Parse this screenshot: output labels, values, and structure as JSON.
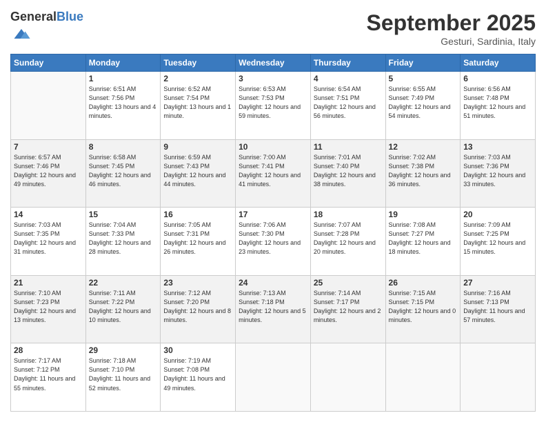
{
  "logo": {
    "general": "General",
    "blue": "Blue"
  },
  "header": {
    "month": "September 2025",
    "location": "Gesturi, Sardinia, Italy"
  },
  "weekdays": [
    "Sunday",
    "Monday",
    "Tuesday",
    "Wednesday",
    "Thursday",
    "Friday",
    "Saturday"
  ],
  "weeks": [
    [
      {
        "day": "",
        "info": ""
      },
      {
        "day": "1",
        "info": "Sunrise: 6:51 AM\nSunset: 7:56 PM\nDaylight: 13 hours\nand 4 minutes."
      },
      {
        "day": "2",
        "info": "Sunrise: 6:52 AM\nSunset: 7:54 PM\nDaylight: 13 hours\nand 1 minute."
      },
      {
        "day": "3",
        "info": "Sunrise: 6:53 AM\nSunset: 7:53 PM\nDaylight: 12 hours\nand 59 minutes."
      },
      {
        "day": "4",
        "info": "Sunrise: 6:54 AM\nSunset: 7:51 PM\nDaylight: 12 hours\nand 56 minutes."
      },
      {
        "day": "5",
        "info": "Sunrise: 6:55 AM\nSunset: 7:49 PM\nDaylight: 12 hours\nand 54 minutes."
      },
      {
        "day": "6",
        "info": "Sunrise: 6:56 AM\nSunset: 7:48 PM\nDaylight: 12 hours\nand 51 minutes."
      }
    ],
    [
      {
        "day": "7",
        "info": "Sunrise: 6:57 AM\nSunset: 7:46 PM\nDaylight: 12 hours\nand 49 minutes."
      },
      {
        "day": "8",
        "info": "Sunrise: 6:58 AM\nSunset: 7:45 PM\nDaylight: 12 hours\nand 46 minutes."
      },
      {
        "day": "9",
        "info": "Sunrise: 6:59 AM\nSunset: 7:43 PM\nDaylight: 12 hours\nand 44 minutes."
      },
      {
        "day": "10",
        "info": "Sunrise: 7:00 AM\nSunset: 7:41 PM\nDaylight: 12 hours\nand 41 minutes."
      },
      {
        "day": "11",
        "info": "Sunrise: 7:01 AM\nSunset: 7:40 PM\nDaylight: 12 hours\nand 38 minutes."
      },
      {
        "day": "12",
        "info": "Sunrise: 7:02 AM\nSunset: 7:38 PM\nDaylight: 12 hours\nand 36 minutes."
      },
      {
        "day": "13",
        "info": "Sunrise: 7:03 AM\nSunset: 7:36 PM\nDaylight: 12 hours\nand 33 minutes."
      }
    ],
    [
      {
        "day": "14",
        "info": "Sunrise: 7:03 AM\nSunset: 7:35 PM\nDaylight: 12 hours\nand 31 minutes."
      },
      {
        "day": "15",
        "info": "Sunrise: 7:04 AM\nSunset: 7:33 PM\nDaylight: 12 hours\nand 28 minutes."
      },
      {
        "day": "16",
        "info": "Sunrise: 7:05 AM\nSunset: 7:31 PM\nDaylight: 12 hours\nand 26 minutes."
      },
      {
        "day": "17",
        "info": "Sunrise: 7:06 AM\nSunset: 7:30 PM\nDaylight: 12 hours\nand 23 minutes."
      },
      {
        "day": "18",
        "info": "Sunrise: 7:07 AM\nSunset: 7:28 PM\nDaylight: 12 hours\nand 20 minutes."
      },
      {
        "day": "19",
        "info": "Sunrise: 7:08 AM\nSunset: 7:27 PM\nDaylight: 12 hours\nand 18 minutes."
      },
      {
        "day": "20",
        "info": "Sunrise: 7:09 AM\nSunset: 7:25 PM\nDaylight: 12 hours\nand 15 minutes."
      }
    ],
    [
      {
        "day": "21",
        "info": "Sunrise: 7:10 AM\nSunset: 7:23 PM\nDaylight: 12 hours\nand 13 minutes."
      },
      {
        "day": "22",
        "info": "Sunrise: 7:11 AM\nSunset: 7:22 PM\nDaylight: 12 hours\nand 10 minutes."
      },
      {
        "day": "23",
        "info": "Sunrise: 7:12 AM\nSunset: 7:20 PM\nDaylight: 12 hours\nand 8 minutes."
      },
      {
        "day": "24",
        "info": "Sunrise: 7:13 AM\nSunset: 7:18 PM\nDaylight: 12 hours\nand 5 minutes."
      },
      {
        "day": "25",
        "info": "Sunrise: 7:14 AM\nSunset: 7:17 PM\nDaylight: 12 hours\nand 2 minutes."
      },
      {
        "day": "26",
        "info": "Sunrise: 7:15 AM\nSunset: 7:15 PM\nDaylight: 12 hours\nand 0 minutes."
      },
      {
        "day": "27",
        "info": "Sunrise: 7:16 AM\nSunset: 7:13 PM\nDaylight: 11 hours\nand 57 minutes."
      }
    ],
    [
      {
        "day": "28",
        "info": "Sunrise: 7:17 AM\nSunset: 7:12 PM\nDaylight: 11 hours\nand 55 minutes."
      },
      {
        "day": "29",
        "info": "Sunrise: 7:18 AM\nSunset: 7:10 PM\nDaylight: 11 hours\nand 52 minutes."
      },
      {
        "day": "30",
        "info": "Sunrise: 7:19 AM\nSunset: 7:08 PM\nDaylight: 11 hours\nand 49 minutes."
      },
      {
        "day": "",
        "info": ""
      },
      {
        "day": "",
        "info": ""
      },
      {
        "day": "",
        "info": ""
      },
      {
        "day": "",
        "info": ""
      }
    ]
  ]
}
